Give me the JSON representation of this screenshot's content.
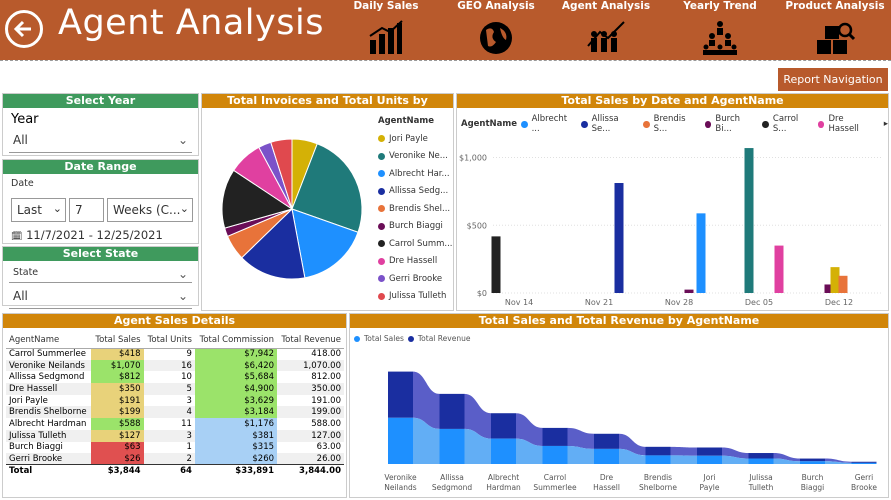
{
  "header": {
    "title": "Agent Analysis",
    "nav": [
      "Daily Sales",
      "GEO Analysis",
      "Agent Analysis",
      "Yearly Trend",
      "Product Analysis"
    ],
    "report_nav": "Report Navigation"
  },
  "slicers": {
    "year_header": "Select Year",
    "year_label": "Year",
    "year_value": "All",
    "date_header": "Date Range",
    "date_label": "Date",
    "date_mode": "Last",
    "date_count": "7",
    "date_unit": "Weeks (C...",
    "date_range": "11/7/2021 - 12/25/2021",
    "state_header": "Select State",
    "state_label": "State",
    "state_value": "All"
  },
  "pie": {
    "title": "Total Invoices and Total Units by AgentName",
    "legend_title": "AgentName",
    "items": [
      {
        "name": "Jori Payle",
        "color": "#d4b106"
      },
      {
        "name": "Veronike Ne...",
        "color": "#1f7a7a"
      },
      {
        "name": "Albrecht Har...",
        "color": "#1e90ff"
      },
      {
        "name": "Allissa Sedg...",
        "color": "#1a2ea0"
      },
      {
        "name": "Brendis Shel...",
        "color": "#e8733a"
      },
      {
        "name": "Burch Biaggi",
        "color": "#6a0d57"
      },
      {
        "name": "Carrol Summ...",
        "color": "#222222"
      },
      {
        "name": "Dre Hassell",
        "color": "#e040a0"
      },
      {
        "name": "Gerri Brooke",
        "color": "#7b52c9"
      },
      {
        "name": "Julissa Tulleth",
        "color": "#e0494e"
      }
    ]
  },
  "bar": {
    "title": "Total Sales by Date and AgentName",
    "legend_title": "AgentName",
    "legend": [
      {
        "name": "Albrecht ...",
        "color": "#1e90ff"
      },
      {
        "name": "Allissa Se...",
        "color": "#1a2ea0"
      },
      {
        "name": "Brendis S...",
        "color": "#e8733a"
      },
      {
        "name": "Burch Bi...",
        "color": "#6a0d57"
      },
      {
        "name": "Carrol S...",
        "color": "#222222"
      },
      {
        "name": "Dre Hassell",
        "color": "#e040a0"
      }
    ],
    "y_ticks": [
      "$1,000",
      "$500",
      "$0"
    ],
    "x_ticks": [
      "Nov 14",
      "Nov 21",
      "Nov 28",
      "Dec 05",
      "Dec 12"
    ]
  },
  "details": {
    "title": "Agent Sales Details",
    "columns": [
      "AgentName",
      "Total Sales",
      "Total Units",
      "Total Commission",
      "Total Revenue"
    ],
    "rows": [
      {
        "name": "Carrol Summerlee",
        "sales": "$418",
        "units": "9",
        "commission": "$7,942",
        "revenue": "418.00",
        "sc": "#e8d27a",
        "cc": "#9be36a"
      },
      {
        "name": "Veronike Neilands",
        "sales": "$1,070",
        "units": "16",
        "commission": "$6,420",
        "revenue": "1,070.00",
        "sc": "#9be36a",
        "cc": "#9be36a"
      },
      {
        "name": "Allissa Sedgmond",
        "sales": "$812",
        "units": "10",
        "commission": "$5,684",
        "revenue": "812.00",
        "sc": "#9be36a",
        "cc": "#9be36a"
      },
      {
        "name": "Dre Hassell",
        "sales": "$350",
        "units": "5",
        "commission": "$4,900",
        "revenue": "350.00",
        "sc": "#e8d27a",
        "cc": "#9be36a"
      },
      {
        "name": "Jori Payle",
        "sales": "$191",
        "units": "3",
        "commission": "$3,629",
        "revenue": "191.00",
        "sc": "#e8d27a",
        "cc": "#9be36a"
      },
      {
        "name": "Brendis Shelborne",
        "sales": "$199",
        "units": "4",
        "commission": "$3,184",
        "revenue": "199.00",
        "sc": "#e8d27a",
        "cc": "#9be36a"
      },
      {
        "name": "Albrecht Hardman",
        "sales": "$588",
        "units": "11",
        "commission": "$1,176",
        "revenue": "588.00",
        "sc": "#9be36a",
        "cc": "#a8d0f5"
      },
      {
        "name": "Julissa Tulleth",
        "sales": "$127",
        "units": "3",
        "commission": "$381",
        "revenue": "127.00",
        "sc": "#e8d27a",
        "cc": "#a8d0f5"
      },
      {
        "name": "Burch Biaggi",
        "sales": "$63",
        "units": "1",
        "commission": "$315",
        "revenue": "63.00",
        "sc": "#e05050",
        "cc": "#a8d0f5"
      },
      {
        "name": "Gerri Brooke",
        "sales": "$26",
        "units": "2",
        "commission": "$260",
        "revenue": "26.00",
        "sc": "#e05050",
        "cc": "#a8d0f5"
      }
    ],
    "total": {
      "name": "Total",
      "sales": "$3,844",
      "units": "64",
      "commission": "$33,891",
      "revenue": "3,844.00"
    }
  },
  "ribbon": {
    "title": "Total Sales and Total Revenue by AgentName",
    "legend": [
      {
        "name": "Total Sales",
        "color": "#1e90ff"
      },
      {
        "name": "Total Revenue",
        "color": "#1a2ea0"
      }
    ],
    "labels": [
      "Veronike Neilands",
      "Allissa Sedgmond",
      "Albrecht Hardman",
      "Carrol Summerlee",
      "Dre Hassell",
      "Brendis Shelborne",
      "Jori Payle",
      "Julissa Tulleth",
      "Burch Biaggi",
      "Gerri Brooke"
    ]
  },
  "chart_data": [
    {
      "type": "pie",
      "title": "Total Invoices and Total Units by AgentName",
      "categories": [
        "Jori Payle",
        "Veronike Neilands",
        "Albrecht Hardman",
        "Allissa Sedgmond",
        "Brendis Shelborne",
        "Burch Biaggi",
        "Carrol Summerlee",
        "Dre Hassell",
        "Gerri Brooke",
        "Julissa Tulleth"
      ],
      "values": [
        6,
        25,
        17,
        16,
        6,
        2,
        14,
        8,
        3,
        5
      ]
    },
    {
      "type": "bar",
      "title": "Total Sales by Date and AgentName",
      "series": [
        {
          "name": "Carrol Summerlee",
          "x": [
            "Nov 14"
          ],
          "values": [
            418
          ]
        },
        {
          "name": "Allissa Sedgmond",
          "x": [
            "Nov 21"
          ],
          "values": [
            812
          ]
        },
        {
          "name": "Burch Biaggi",
          "x": [
            "Nov 28",
            "Dec 12"
          ],
          "values": [
            25,
            63
          ]
        },
        {
          "name": "Albrecht Hardman",
          "x": [
            "Nov 28"
          ],
          "values": [
            588
          ]
        },
        {
          "name": "Veronike Neilands",
          "x": [
            "Dec 05"
          ],
          "values": [
            1070
          ]
        },
        {
          "name": "Dre Hassell",
          "x": [
            "Dec 05"
          ],
          "values": [
            350
          ]
        },
        {
          "name": "Jori Payle",
          "x": [
            "Dec 12"
          ],
          "values": [
            191
          ]
        },
        {
          "name": "Brendis Shelborne",
          "x": [
            "Dec 12"
          ],
          "values": [
            127
          ]
        }
      ],
      "ylim": [
        0,
        1100
      ]
    },
    {
      "type": "area",
      "title": "Total Sales and Total Revenue by AgentName",
      "categories": [
        "Veronike Neilands",
        "Allissa Sedgmond",
        "Albrecht Hardman",
        "Carrol Summerlee",
        "Dre Hassell",
        "Brendis Shelborne",
        "Jori Payle",
        "Julissa Tulleth",
        "Burch Biaggi",
        "Gerri Brooke"
      ],
      "series": [
        {
          "name": "Total Sales",
          "values": [
            1070,
            812,
            588,
            418,
            350,
            199,
            191,
            127,
            63,
            26
          ]
        },
        {
          "name": "Total Revenue",
          "values": [
            1070,
            812,
            588,
            418,
            350,
            199,
            191,
            127,
            63,
            26
          ]
        }
      ]
    }
  ]
}
